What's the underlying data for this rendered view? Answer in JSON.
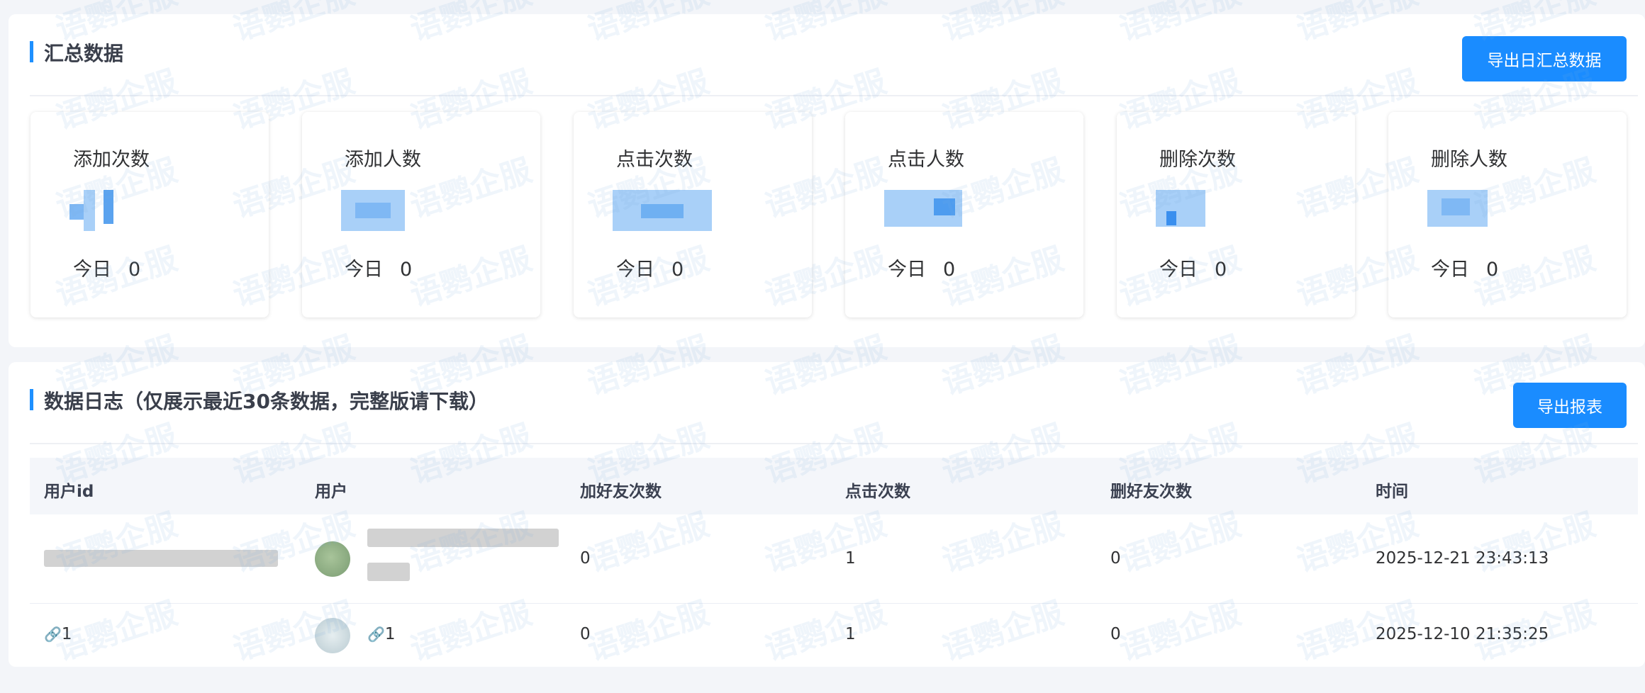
{
  "summary": {
    "title": "汇总数据",
    "export_button": "导出日汇总数据",
    "today_label": "今日",
    "cards": [
      {
        "label": "添加次数",
        "today": "0"
      },
      {
        "label": "添加人数",
        "today": "0"
      },
      {
        "label": "点击次数",
        "today": "0"
      },
      {
        "label": "点击人数",
        "today": "0"
      },
      {
        "label": "删除次数",
        "today": "0"
      },
      {
        "label": "删除人数",
        "today": "0"
      }
    ]
  },
  "log": {
    "title": "数据日志（仅展示最近30条数据，完整版请下载）",
    "export_button": "导出报表",
    "columns": [
      "用户id",
      "用户",
      "加好友次数",
      "点击次数",
      "删好友次数",
      "时间"
    ],
    "rows": [
      {
        "user_id": "",
        "user_name": "",
        "add_friend": "0",
        "clicks": "1",
        "delete_friend": "0",
        "time": "2025-12-21 23:43:13"
      },
      {
        "user_id": "1",
        "user_name": "1",
        "add_friend": "0",
        "clicks": "1",
        "delete_friend": "0",
        "time": "2025-12-10 21:35:25"
      }
    ]
  },
  "watermark": {
    "text": "语鹦企服"
  },
  "colors": {
    "accent": "#1a8cff",
    "page_bg": "#f3f5f9",
    "table_head_bg": "#f4f6fa"
  }
}
